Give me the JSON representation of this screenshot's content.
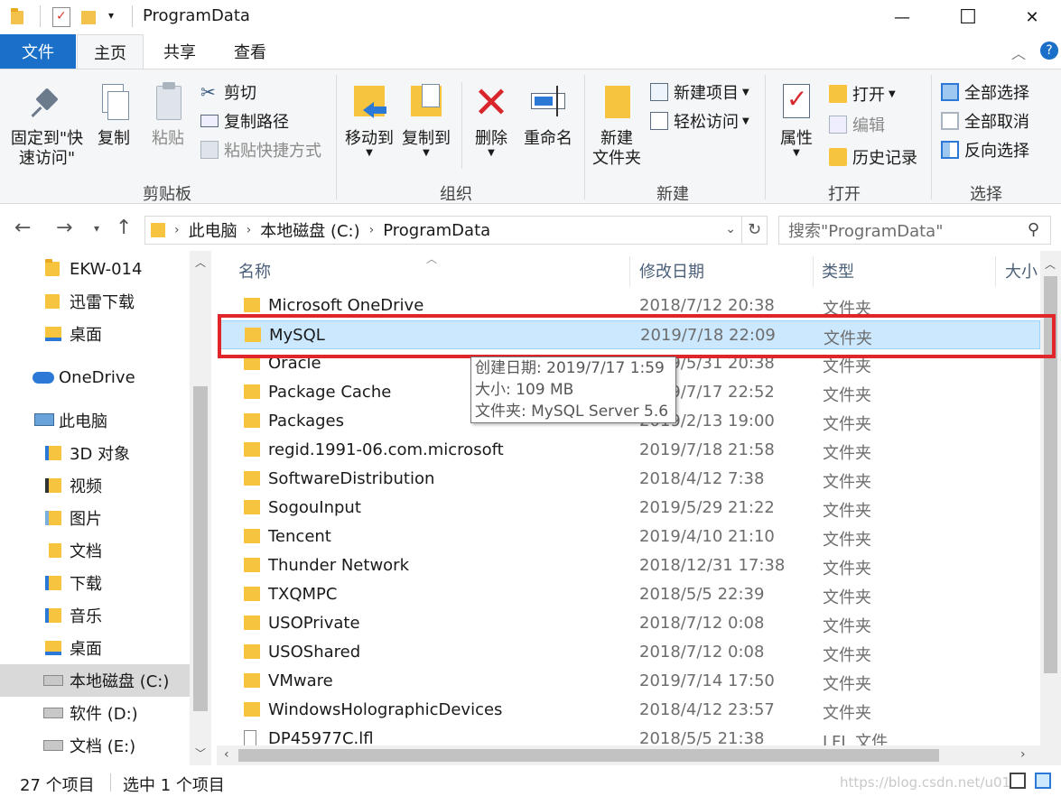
{
  "window": {
    "title": "ProgramData",
    "minimize": "—",
    "maximize": "☐",
    "close": "✕"
  },
  "tabs": [
    {
      "label": "文件"
    },
    {
      "label": "主页"
    },
    {
      "label": "共享"
    },
    {
      "label": "查看"
    }
  ],
  "ribbon": {
    "clipboard": {
      "group": "剪贴板",
      "pin_line1": "固定到\"快",
      "pin_line2": "速访问\"",
      "copy": "复制",
      "paste": "粘贴",
      "cut": "剪切",
      "copy_path": "复制路径",
      "paste_shortcut": "粘贴快捷方式"
    },
    "organize": {
      "group": "组织",
      "move_to": "移动到",
      "copy_to": "复制到",
      "delete": "删除",
      "rename": "重命名"
    },
    "new": {
      "group": "新建",
      "new_folder_line1": "新建",
      "new_folder_line2": "文件夹",
      "new_item": "新建项目",
      "easy_access": "轻松访问"
    },
    "open": {
      "group": "打开",
      "properties": "属性",
      "open": "打开",
      "edit": "编辑",
      "history": "历史记录"
    },
    "select": {
      "group": "选择",
      "select_all": "全部选择",
      "select_none": "全部取消",
      "invert": "反向选择"
    }
  },
  "address": {
    "crumbs": [
      "此电脑",
      "本地磁盘 (C:)",
      "ProgramData"
    ],
    "search_placeholder": "搜索\"ProgramData\""
  },
  "nav": [
    {
      "label": "EKW-014"
    },
    {
      "label": "迅雷下载"
    },
    {
      "label": "桌面"
    },
    {
      "label": "OneDrive"
    },
    {
      "label": "此电脑"
    },
    {
      "label": "3D 对象"
    },
    {
      "label": "视频"
    },
    {
      "label": "图片"
    },
    {
      "label": "文档"
    },
    {
      "label": "下载"
    },
    {
      "label": "音乐"
    },
    {
      "label": "桌面"
    },
    {
      "label": "本地磁盘 (C:)"
    },
    {
      "label": "软件 (D:)"
    },
    {
      "label": "文档 (E:)"
    }
  ],
  "columns": {
    "name": "名称",
    "modified": "修改日期",
    "type": "类型",
    "size": "大小"
  },
  "files": [
    {
      "name": "Microsoft OneDrive",
      "date": "2018/7/12 20:38",
      "type": "文件夹"
    },
    {
      "name": "MySQL",
      "date": "2019/7/18 22:09",
      "type": "文件夹"
    },
    {
      "name": "Oracle",
      "date": "2019/5/31 20:38",
      "type": "文件夹"
    },
    {
      "name": "Package Cache",
      "date": "2019/7/17 22:52",
      "type": "文件夹"
    },
    {
      "name": "Packages",
      "date": "2019/2/13 19:00",
      "type": "文件夹"
    },
    {
      "name": "regid.1991-06.com.microsoft",
      "date": "2019/7/18 21:58",
      "type": "文件夹"
    },
    {
      "name": "SoftwareDistribution",
      "date": "2018/4/12 7:38",
      "type": "文件夹"
    },
    {
      "name": "SogouInput",
      "date": "2019/5/29 21:22",
      "type": "文件夹"
    },
    {
      "name": "Tencent",
      "date": "2019/4/10 21:10",
      "type": "文件夹"
    },
    {
      "name": "Thunder Network",
      "date": "2018/12/31 17:38",
      "type": "文件夹"
    },
    {
      "name": "TXQMPC",
      "date": "2018/5/5 22:39",
      "type": "文件夹"
    },
    {
      "name": "USOPrivate",
      "date": "2018/7/12 0:08",
      "type": "文件夹"
    },
    {
      "name": "USOShared",
      "date": "2018/7/12 0:08",
      "type": "文件夹"
    },
    {
      "name": "VMware",
      "date": "2019/7/14 17:50",
      "type": "文件夹"
    },
    {
      "name": "WindowsHolographicDevices",
      "date": "2018/4/12 23:57",
      "type": "文件夹"
    },
    {
      "name": "DP45977C.lfl",
      "date": "2018/5/5 21:38",
      "type": "LFL 文件"
    }
  ],
  "tooltip": {
    "created": "创建日期: 2019/7/17 1:59",
    "size": "大小: 109 MB",
    "folders": "文件夹: MySQL Server 5.6"
  },
  "status": {
    "count": "27 个项目",
    "selected": "选中 1 个项目"
  },
  "watermark": "https://blog.csdn.net/u01"
}
